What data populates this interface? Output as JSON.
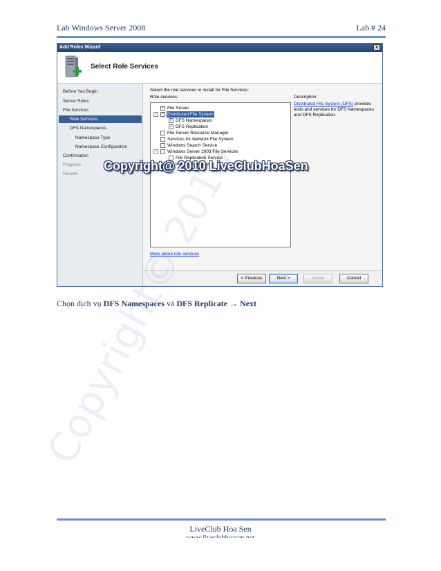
{
  "header": {
    "left": "Lab Windows Server 2008",
    "right": "Lab # 24"
  },
  "wizard": {
    "title": "Add Roles Wizard",
    "close_glyph": "x",
    "banner_title": "Select Role Services",
    "banner_icon": "server-add-icon",
    "nav": {
      "items": [
        {
          "label": "Before You Begin",
          "state": "normal"
        },
        {
          "label": "Server Roles",
          "state": "normal"
        },
        {
          "label": "File Services",
          "state": "normal"
        },
        {
          "label": "Role Services",
          "state": "selected"
        },
        {
          "label": "DFS Namespaces",
          "state": "normal"
        },
        {
          "label": "Namespace Type",
          "state": "normal"
        },
        {
          "label": "Namespace Configuration",
          "state": "normal"
        },
        {
          "label": "Confirmation",
          "state": "normal"
        },
        {
          "label": "Progress",
          "state": "disabled"
        },
        {
          "label": "Results",
          "state": "disabled"
        }
      ]
    },
    "instruction": "Select the role services to install for File Services:",
    "role_services_label": "Role services:",
    "tree": [
      {
        "label": "File Server",
        "checked": true
      },
      {
        "label": "Distributed File System",
        "checked": true,
        "expander": "−",
        "highlighted": true
      },
      {
        "label": "DFS Namespaces",
        "checked": true
      },
      {
        "label": "DFS Replication",
        "checked": true
      },
      {
        "label": "File Server Resource Manager",
        "checked": false
      },
      {
        "label": "Services for Network File System",
        "checked": false
      },
      {
        "label": "Windows Search Service",
        "checked": false
      },
      {
        "label": "Windows Server 2003 File Services",
        "checked": false,
        "expander": "−"
      },
      {
        "label": "File Replication Service",
        "checked": false
      },
      {
        "label": "Indexing Service",
        "checked": false
      }
    ],
    "description_label": "Description:",
    "description_link": "Distributed File System (DFS)",
    "description_rest": " provides tools and services for DFS Namespaces and DFS Replication.",
    "more_link": "More about role services",
    "buttons": {
      "previous": "< Previous",
      "next": "Next >",
      "install": "Install",
      "cancel": "Cancel"
    }
  },
  "watermark": {
    "banner": "Copyright@ 2010 LiveClubHoaSen",
    "diagonal": "Copyright© 2010"
  },
  "caption": {
    "prefix": "Chọn dịch vụ ",
    "bold1": "DFS Namespaces",
    "mid": " và ",
    "bold2": "DFS Replicate",
    "arrow": " → ",
    "bold3": "Next"
  },
  "footer": {
    "title": "LiveClub Hoa Sen",
    "subtitle": "www.liveclubhoasen.net"
  }
}
